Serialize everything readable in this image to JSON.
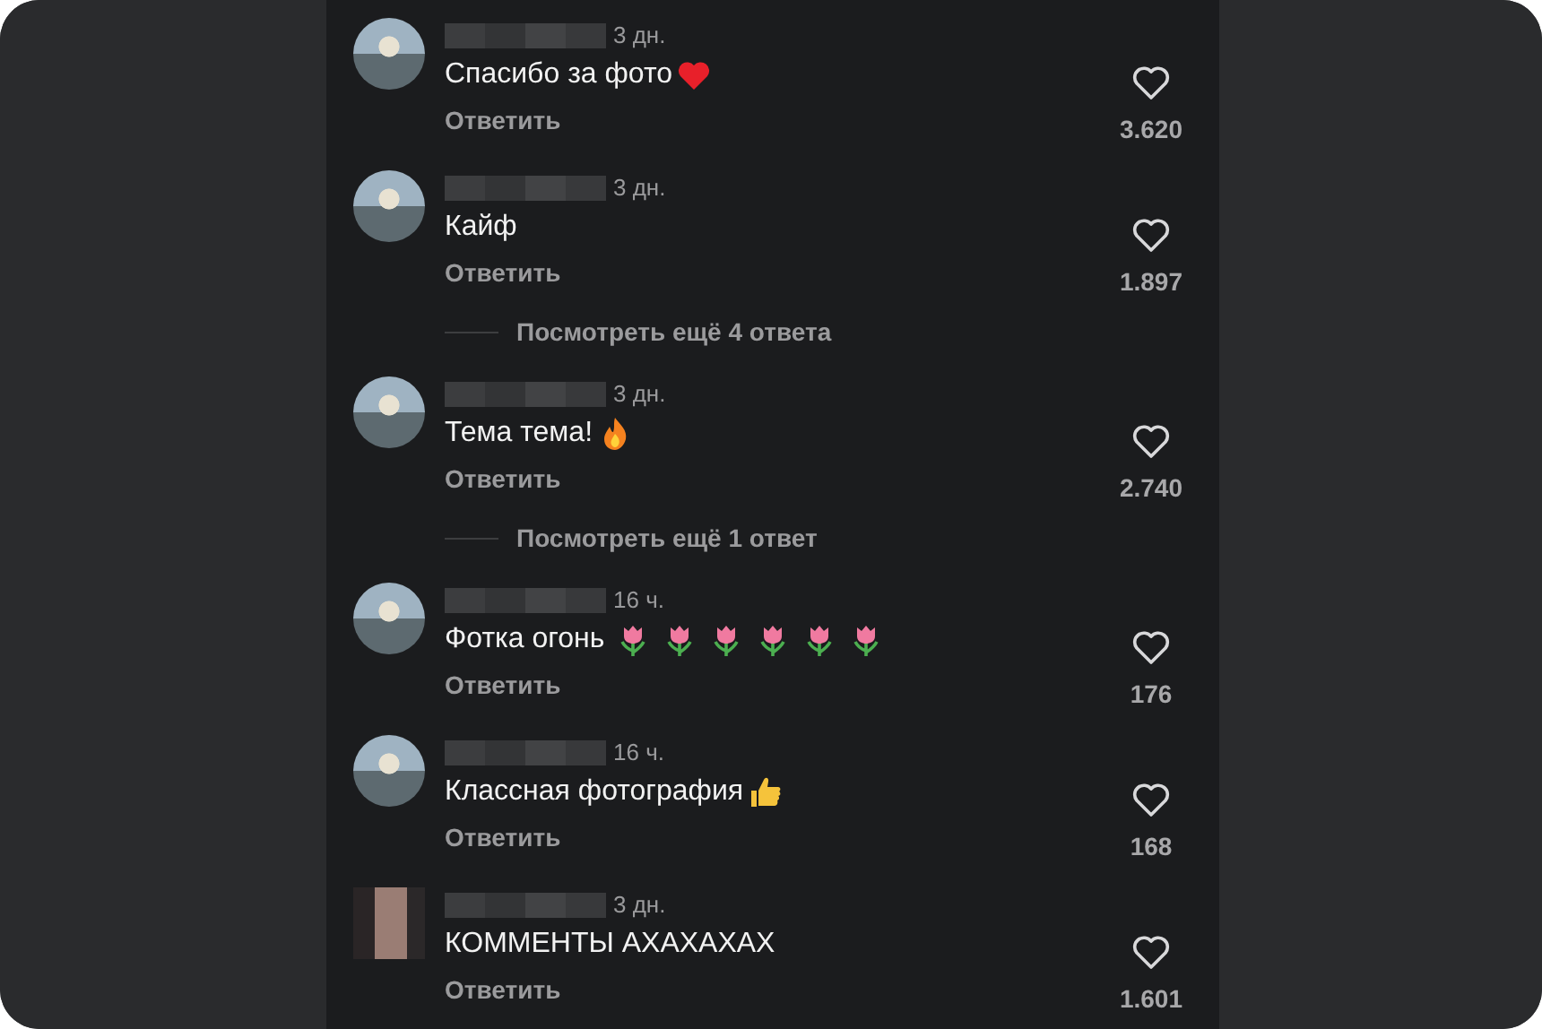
{
  "comments": [
    {
      "avatar": {
        "kind": "photo"
      },
      "time": "3 дн.",
      "text": "Спасибо за фото",
      "emoji": [
        {
          "kind": "heart"
        }
      ],
      "reply": "Ответить",
      "likes": "3.620"
    },
    {
      "avatar": {
        "kind": "photo"
      },
      "time": "3 дн.",
      "text": "Кайф",
      "reply": "Ответить",
      "likes": "1.897",
      "more_replies": "Посмотреть ещё 4 ответа"
    },
    {
      "avatar": {
        "kind": "photo"
      },
      "time": "3 дн.",
      "text": "Тема тема!",
      "emoji": [
        {
          "kind": "fire"
        }
      ],
      "reply": "Ответить",
      "likes": "2.740",
      "more_replies": "Посмотреть ещё 1 ответ"
    },
    {
      "avatar": {
        "kind": "photo"
      },
      "time": "16 ч.",
      "text": "Фотка огонь",
      "emoji": [
        {
          "kind": "tulip"
        },
        {
          "kind": "tulip"
        },
        {
          "kind": "tulip"
        },
        {
          "kind": "tulip"
        },
        {
          "kind": "tulip"
        },
        {
          "kind": "tulip"
        }
      ],
      "reply": "Ответить",
      "likes": "176"
    },
    {
      "avatar": {
        "kind": "photo"
      },
      "time": "16 ч.",
      "text": "Классная фотография",
      "emoji": [
        {
          "kind": "thumbs-up"
        }
      ],
      "reply": "Ответить",
      "likes": "168"
    },
    {
      "avatar": {
        "kind": "pixelated"
      },
      "time": "3 дн.",
      "text": "КОММЕНТЫ АХАХАХАХ",
      "reply": "Ответить",
      "likes": "1.601"
    }
  ]
}
